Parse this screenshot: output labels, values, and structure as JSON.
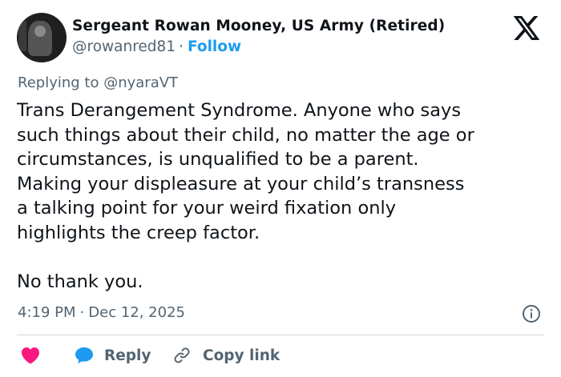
{
  "author": {
    "name": "Sergeant Rowan Mooney, US Army (Retired)",
    "handle": "@rowanred81",
    "separator": "·",
    "follow_label": "Follow"
  },
  "reply_context": {
    "text": "Replying to @nyaraVT"
  },
  "tweet": {
    "lines": [
      "Trans Derangement Syndrome. Anyone who says",
      "such things about their child, no matter the age or",
      "circumstances, is unqualified to be a parent.",
      "Making your displeasure at your child’s transness",
      "a talking point for your weird fixation only",
      "highlights the creep factor.",
      "No thank you."
    ]
  },
  "meta": {
    "time": "4:19 PM",
    "separator": "·",
    "date": "Dec 12, 2025"
  },
  "actions": {
    "like_icon": "heart-icon",
    "reply_label": "Reply",
    "reply_icon": "chat-bubble-icon",
    "copy_label": "Copy link",
    "copy_icon": "link-icon"
  },
  "icons": {
    "logo": "x-logo-icon",
    "info": "info-icon"
  },
  "colors": {
    "text": "#0f1419",
    "secondary": "#536471",
    "accent": "#1d9bf0",
    "like": "#f91880",
    "divider": "#cfd9de"
  }
}
